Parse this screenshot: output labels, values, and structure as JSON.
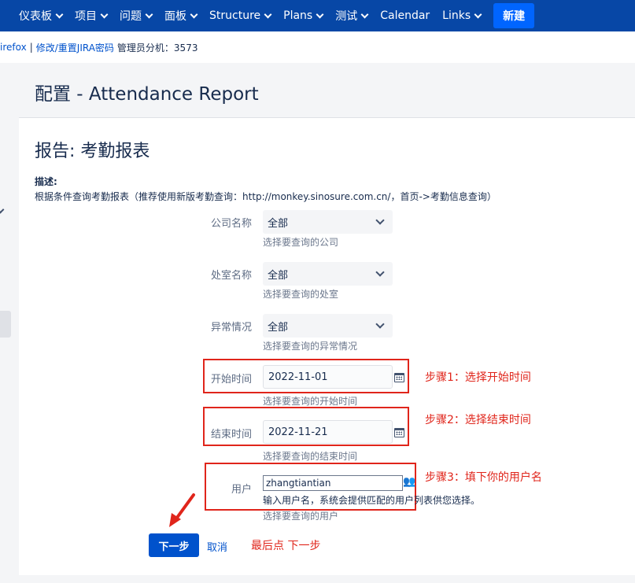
{
  "nav": {
    "items": [
      {
        "label": "仪表板",
        "dropdown": true
      },
      {
        "label": "项目",
        "dropdown": true
      },
      {
        "label": "问题",
        "dropdown": true
      },
      {
        "label": "面板",
        "dropdown": true
      },
      {
        "label": "Structure",
        "dropdown": true
      },
      {
        "label": "Plans",
        "dropdown": true
      },
      {
        "label": "测试",
        "dropdown": true
      },
      {
        "label": "Calendar",
        "dropdown": false
      },
      {
        "label": "Links",
        "dropdown": true
      }
    ],
    "create_label": "新建"
  },
  "announcement": {
    "link1": "irefox",
    "separator": "|",
    "link2": "修改/重置JIRA密码",
    "admin_text": "管理员分机：3573"
  },
  "page": {
    "title": "配置 - Attendance Report"
  },
  "report": {
    "title": "报告: 考勤报表",
    "desc_label": "描述:",
    "desc_text": "根据条件查询考勤报表（推荐使用新版考勤查询：http://monkey.sinosure.com.cn/，首页->考勤信息查询）"
  },
  "form": {
    "company": {
      "label": "公司名称",
      "value": "全部",
      "help": "选择要查询的公司"
    },
    "department": {
      "label": "处室名称",
      "value": "全部",
      "help": "选择要查询的处室"
    },
    "exception": {
      "label": "异常情况",
      "value": "全部",
      "help": "选择要查询的异常情况"
    },
    "start": {
      "label": "开始时间",
      "value": "2022-11-01",
      "help": "选择要查询的开始时间"
    },
    "end": {
      "label": "结束时间",
      "value": "2022-11-21",
      "help": "选择要查询的结束时间"
    },
    "user": {
      "label": "用户",
      "value": "zhangtiantian",
      "hint": "输入用户名，系统会提供匹配的用户列表供您选择。",
      "help": "选择要查询的用户"
    },
    "next_label": "下一步",
    "cancel_label": "取消"
  },
  "annotations": {
    "step1": "步骤1：选择开始时间",
    "step2": "步骤2：选择结束时间",
    "step3": "步骤3：填下你的用户名",
    "final": "最后点 下一步"
  },
  "colors": {
    "nav_bg": "#0747a6",
    "create_bg": "#0065ff",
    "primary": "#0052cc",
    "annotation_red": "#e0251b"
  },
  "icons": {
    "calendar": "calendar-icon",
    "users": "users-icon",
    "dropdown": "chevron-down-icon",
    "arrow": "red-arrow-icon"
  }
}
